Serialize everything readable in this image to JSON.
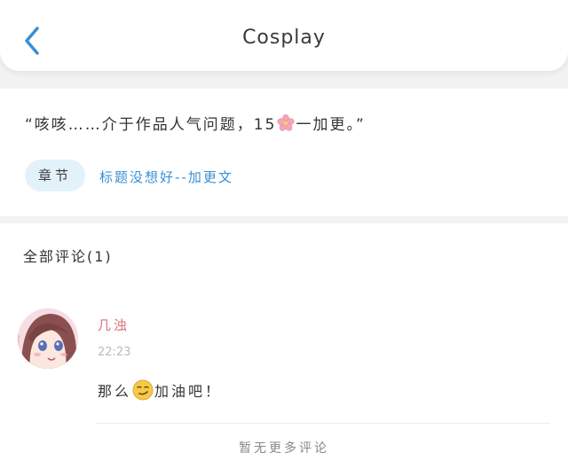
{
  "header": {
    "title": "Cosplay",
    "back_icon": "chevron-left-icon"
  },
  "colors": {
    "accent": "#3a8fd4",
    "tag_bg": "#e3f1fb",
    "username": "#d9727e"
  },
  "chapter": {
    "quote_before": "“咳咳……介于作品人气问题，15",
    "quote_icon": "sakura-flower-icon",
    "quote_after": "一加更。”",
    "tag_label": "章节",
    "link_text": "标题没想好--加更文"
  },
  "comments": {
    "header": "全部评论(1)",
    "items": [
      {
        "avatar_icon": "anime-avatar",
        "username": "几浊",
        "time": "22:23",
        "text_before": "那么",
        "emoji": "smirk-emoji",
        "text_after": "加油吧！"
      }
    ],
    "no_more": "暂无更多评论"
  }
}
